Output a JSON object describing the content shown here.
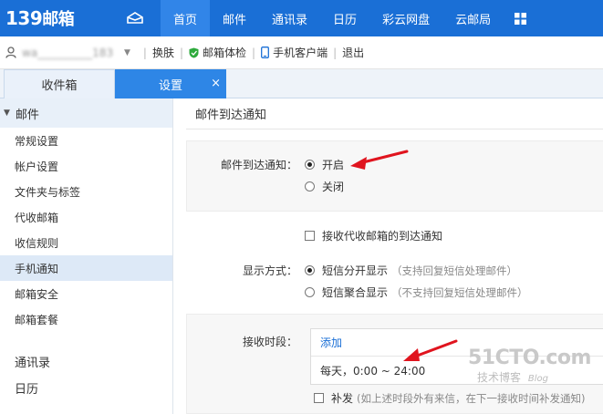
{
  "logo": {
    "number": "139",
    "text": "邮箱"
  },
  "nav": {
    "items": [
      {
        "label": "首页",
        "active": true
      },
      {
        "label": "邮件",
        "active": false
      },
      {
        "label": "通讯录",
        "active": false
      },
      {
        "label": "日历",
        "active": false
      },
      {
        "label": "彩云网盘",
        "active": false
      },
      {
        "label": "云邮局",
        "active": false
      }
    ]
  },
  "userbar": {
    "username": "wa__________183",
    "skin": "换肤",
    "check": "邮箱体检",
    "mobile_client": "手机客户端",
    "logout": "退出",
    "separator": "|"
  },
  "tabs": {
    "inbox": "收件箱",
    "settings": "设置",
    "close": "×"
  },
  "sidebar": {
    "group": "邮件",
    "items": [
      "常规设置",
      "帐户设置",
      "文件夹与标签",
      "代收邮箱",
      "收信规则",
      "手机通知",
      "邮箱安全",
      "邮箱套餐"
    ],
    "extra": [
      "通讯录",
      "日历"
    ]
  },
  "main": {
    "title": "邮件到达通知",
    "notify_label": "邮件到达通知：",
    "notify_on": "开启",
    "notify_off": "关闭",
    "proxy_notify": "接收代收邮箱的到达通知",
    "display_label": "显示方式：",
    "display_split": "短信分开显示",
    "display_split_hint": "（支持回复短信处理邮件）",
    "display_merge": "短信聚合显示",
    "display_merge_hint": "（不支持回复短信处理邮件）",
    "time_label": "接收时段：",
    "time_add": "添加",
    "time_value": "每天，0:00 ~ 24:00",
    "resend": "补发",
    "resend_hint": "(如上述时段外有来信，在下一接收时间补发通知)"
  },
  "watermark": {
    "main": "51CTO.com",
    "sub": "技术博客",
    "sub2": "Blog"
  },
  "colors": {
    "nav_bg": "#1a6fd6",
    "nav_active": "#3185e8",
    "tab_active": "#2e86e6",
    "arrow": "#e0141e",
    "link": "#1a6fd6"
  }
}
